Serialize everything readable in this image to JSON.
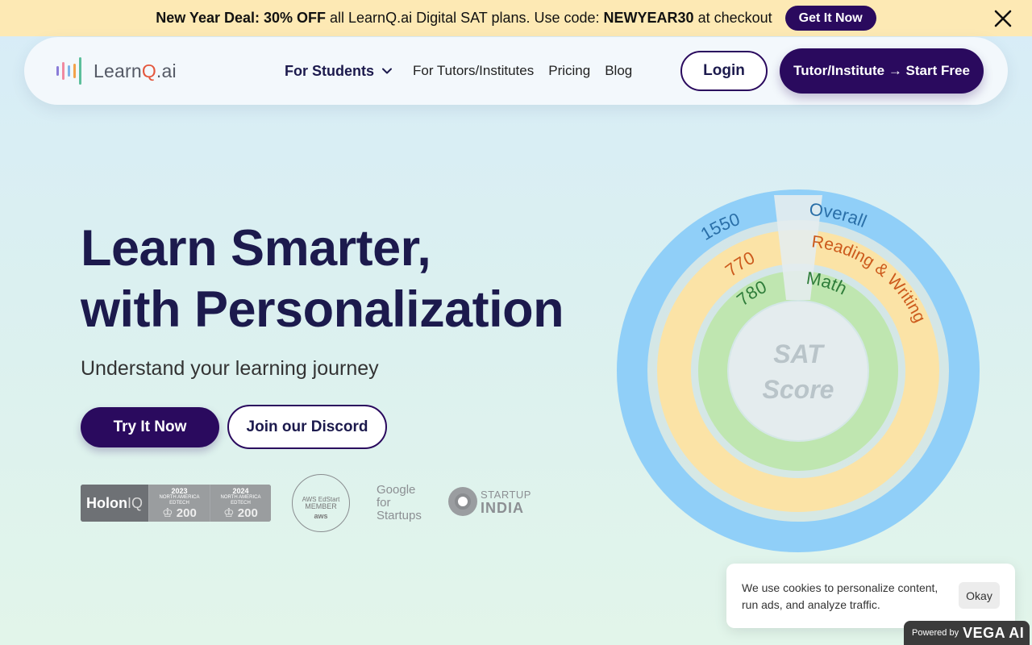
{
  "promo": {
    "lead": "New Year Deal: 30% OFF",
    "middle": " all LearnQ.ai Digital SAT plans. Use code: ",
    "code": "NEWYEAR30",
    "tail": " at checkout",
    "cta": "Get It Now"
  },
  "nav": {
    "logo_prefix": "Learn",
    "logo_q": "Q",
    "logo_suffix": ".ai",
    "students": "For Students",
    "tutors": "For Tutors/Institutes",
    "pricing": "Pricing",
    "blog": "Blog",
    "login": "Login",
    "tutor_cta": "Tutor/Institute → Start Free"
  },
  "hero": {
    "line1": "Learn Smarter,",
    "line2": "with Personalization",
    "subtitle": "Understand your learning journey",
    "try_btn": "Try It Now",
    "discord_btn": "Join our Discord"
  },
  "badges": {
    "holon_brand_a": "Holon",
    "holon_brand_b": "IQ",
    "award1_year": "2023",
    "award2_year": "2024",
    "award_region": "NORTH AMERICA",
    "award_cat": "EDTECH",
    "award_num": "200",
    "aws_l1": "AWS EdStart",
    "aws_l2": "MEMBER",
    "aws_l3": "aws",
    "google_l1": "Google",
    "google_l2": "for",
    "google_l3": "Startups",
    "startup_a": "START",
    "startup_up": "UP",
    "startup_b": "INDIA"
  },
  "score_chart": {
    "center_l1": "SAT",
    "center_l2": "Score",
    "rings": [
      {
        "label": "Overall",
        "value": "1550",
        "color": "#90cff8",
        "text_color": "#2a6fa8"
      },
      {
        "label": "Reading & Writing",
        "value": "770",
        "color": "#fbe3a6",
        "text_color": "#cc5a1c"
      },
      {
        "label": "Math",
        "value": "780",
        "color": "#bfe6b0",
        "text_color": "#2f7d3a"
      }
    ]
  },
  "cookie": {
    "message": "We use cookies to personalize content, run ads, and analyze traffic.",
    "ok": "Okay"
  },
  "powered": {
    "prefix": "Powered by",
    "brand": "VEGA AI"
  }
}
